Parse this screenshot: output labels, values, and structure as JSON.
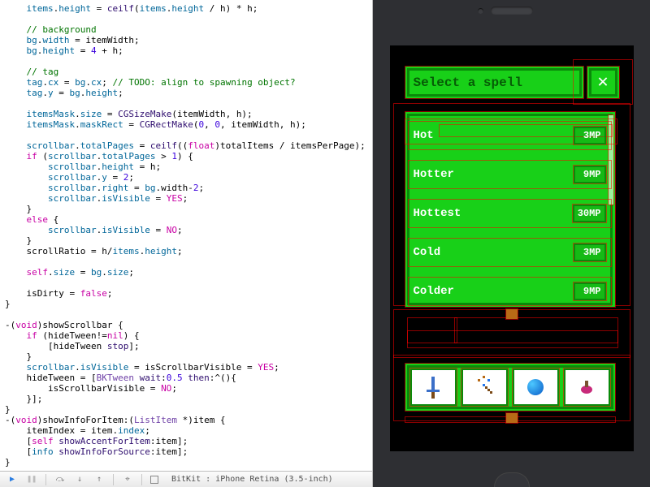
{
  "code": {
    "lines": [
      {
        "indent": 1,
        "segs": [
          {
            "t": "items",
            "c": "var"
          },
          {
            "t": ".",
            "c": ""
          },
          {
            "t": "height",
            "c": "var"
          },
          {
            "t": " = ",
            "c": ""
          },
          {
            "t": "ceilf",
            "c": "fn"
          },
          {
            "t": "(",
            "c": ""
          },
          {
            "t": "items",
            "c": "var"
          },
          {
            "t": ".",
            "c": ""
          },
          {
            "t": "height",
            "c": "var"
          },
          {
            "t": " / h) * h;",
            "c": ""
          }
        ]
      },
      {
        "indent": 0,
        "segs": []
      },
      {
        "indent": 1,
        "segs": [
          {
            "t": "// background",
            "c": "cmt"
          }
        ]
      },
      {
        "indent": 1,
        "segs": [
          {
            "t": "bg",
            "c": "var"
          },
          {
            "t": ".",
            "c": ""
          },
          {
            "t": "width",
            "c": "var"
          },
          {
            "t": " = itemWidth;",
            "c": ""
          }
        ]
      },
      {
        "indent": 1,
        "segs": [
          {
            "t": "bg",
            "c": "var"
          },
          {
            "t": ".",
            "c": ""
          },
          {
            "t": "height",
            "c": "var"
          },
          {
            "t": " = ",
            "c": ""
          },
          {
            "t": "4",
            "c": "num"
          },
          {
            "t": " + h;",
            "c": ""
          }
        ]
      },
      {
        "indent": 0,
        "segs": []
      },
      {
        "indent": 1,
        "segs": [
          {
            "t": "// tag",
            "c": "cmt"
          }
        ]
      },
      {
        "indent": 1,
        "segs": [
          {
            "t": "tag",
            "c": "var"
          },
          {
            "t": ".",
            "c": ""
          },
          {
            "t": "cx",
            "c": "var"
          },
          {
            "t": " = ",
            "c": ""
          },
          {
            "t": "bg",
            "c": "var"
          },
          {
            "t": ".",
            "c": ""
          },
          {
            "t": "cx",
            "c": "var"
          },
          {
            "t": "; ",
            "c": ""
          },
          {
            "t": "// TODO: align to spawning object?",
            "c": "cmt"
          }
        ]
      },
      {
        "indent": 1,
        "segs": [
          {
            "t": "tag",
            "c": "var"
          },
          {
            "t": ".",
            "c": ""
          },
          {
            "t": "y",
            "c": "var"
          },
          {
            "t": " = ",
            "c": ""
          },
          {
            "t": "bg",
            "c": "var"
          },
          {
            "t": ".",
            "c": ""
          },
          {
            "t": "height",
            "c": "var"
          },
          {
            "t": ";",
            "c": ""
          }
        ]
      },
      {
        "indent": 0,
        "segs": []
      },
      {
        "indent": 1,
        "segs": [
          {
            "t": "itemsMask",
            "c": "var"
          },
          {
            "t": ".",
            "c": ""
          },
          {
            "t": "size",
            "c": "var"
          },
          {
            "t": " = ",
            "c": ""
          },
          {
            "t": "CGSizeMake",
            "c": "fn"
          },
          {
            "t": "(itemWidth, h);",
            "c": ""
          }
        ]
      },
      {
        "indent": 1,
        "segs": [
          {
            "t": "itemsMask",
            "c": "var"
          },
          {
            "t": ".",
            "c": ""
          },
          {
            "t": "maskRect",
            "c": "var"
          },
          {
            "t": " = ",
            "c": ""
          },
          {
            "t": "CGRectMake",
            "c": "fn"
          },
          {
            "t": "(",
            "c": ""
          },
          {
            "t": "0",
            "c": "num"
          },
          {
            "t": ", ",
            "c": ""
          },
          {
            "t": "0",
            "c": "num"
          },
          {
            "t": ", itemWidth, h);",
            "c": ""
          }
        ]
      },
      {
        "indent": 0,
        "segs": []
      },
      {
        "indent": 1,
        "segs": [
          {
            "t": "scrollbar",
            "c": "var"
          },
          {
            "t": ".",
            "c": ""
          },
          {
            "t": "totalPages",
            "c": "var"
          },
          {
            "t": " = ",
            "c": ""
          },
          {
            "t": "ceilf",
            "c": "fn"
          },
          {
            "t": "((",
            "c": ""
          },
          {
            "t": "float",
            "c": "kw"
          },
          {
            "t": ")totalItems / itemsPerPage);",
            "c": ""
          }
        ]
      },
      {
        "indent": 1,
        "segs": [
          {
            "t": "if",
            "c": "kw"
          },
          {
            "t": " (",
            "c": ""
          },
          {
            "t": "scrollbar",
            "c": "var"
          },
          {
            "t": ".",
            "c": ""
          },
          {
            "t": "totalPages",
            "c": "var"
          },
          {
            "t": " > ",
            "c": ""
          },
          {
            "t": "1",
            "c": "num"
          },
          {
            "t": ") {",
            "c": ""
          }
        ]
      },
      {
        "indent": 2,
        "segs": [
          {
            "t": "scrollbar",
            "c": "var"
          },
          {
            "t": ".",
            "c": ""
          },
          {
            "t": "height",
            "c": "var"
          },
          {
            "t": " = h;",
            "c": ""
          }
        ]
      },
      {
        "indent": 2,
        "segs": [
          {
            "t": "scrollbar",
            "c": "var"
          },
          {
            "t": ".",
            "c": ""
          },
          {
            "t": "y",
            "c": "var"
          },
          {
            "t": " = ",
            "c": ""
          },
          {
            "t": "2",
            "c": "num"
          },
          {
            "t": ";",
            "c": ""
          }
        ]
      },
      {
        "indent": 2,
        "segs": [
          {
            "t": "scrollbar",
            "c": "var"
          },
          {
            "t": ".",
            "c": ""
          },
          {
            "t": "right",
            "c": "var"
          },
          {
            "t": " = ",
            "c": ""
          },
          {
            "t": "bg",
            "c": "var"
          },
          {
            "t": ".width-",
            "c": ""
          },
          {
            "t": "2",
            "c": "num"
          },
          {
            "t": ";",
            "c": ""
          }
        ]
      },
      {
        "indent": 2,
        "segs": [
          {
            "t": "scrollbar",
            "c": "var"
          },
          {
            "t": ".",
            "c": ""
          },
          {
            "t": "isVisible",
            "c": "var"
          },
          {
            "t": " = ",
            "c": ""
          },
          {
            "t": "YES",
            "c": "kw"
          },
          {
            "t": ";",
            "c": ""
          }
        ]
      },
      {
        "indent": 1,
        "segs": [
          {
            "t": "}",
            "c": ""
          }
        ]
      },
      {
        "indent": 1,
        "segs": [
          {
            "t": "else",
            "c": "kw"
          },
          {
            "t": " {",
            "c": ""
          }
        ]
      },
      {
        "indent": 2,
        "segs": [
          {
            "t": "scrollbar",
            "c": "var"
          },
          {
            "t": ".",
            "c": ""
          },
          {
            "t": "isVisible",
            "c": "var"
          },
          {
            "t": " = ",
            "c": ""
          },
          {
            "t": "NO",
            "c": "kw"
          },
          {
            "t": ";",
            "c": ""
          }
        ]
      },
      {
        "indent": 1,
        "segs": [
          {
            "t": "}",
            "c": ""
          }
        ]
      },
      {
        "indent": 1,
        "segs": [
          {
            "t": "scrollRatio = h/",
            "c": ""
          },
          {
            "t": "items",
            "c": "var"
          },
          {
            "t": ".",
            "c": ""
          },
          {
            "t": "height",
            "c": "var"
          },
          {
            "t": ";",
            "c": ""
          }
        ]
      },
      {
        "indent": 0,
        "segs": []
      },
      {
        "indent": 1,
        "segs": [
          {
            "t": "self",
            "c": "kw"
          },
          {
            "t": ".",
            "c": ""
          },
          {
            "t": "size",
            "c": "var"
          },
          {
            "t": " = ",
            "c": ""
          },
          {
            "t": "bg",
            "c": "var"
          },
          {
            "t": ".",
            "c": ""
          },
          {
            "t": "size",
            "c": "var"
          },
          {
            "t": ";",
            "c": ""
          }
        ]
      },
      {
        "indent": 0,
        "segs": []
      },
      {
        "indent": 1,
        "segs": [
          {
            "t": "isDirty = ",
            "c": ""
          },
          {
            "t": "false",
            "c": "kw"
          },
          {
            "t": ";",
            "c": ""
          }
        ]
      },
      {
        "indent": 0,
        "segs": [
          {
            "t": "}",
            "c": ""
          }
        ]
      },
      {
        "indent": 0,
        "segs": []
      },
      {
        "indent": 0,
        "segs": [
          {
            "t": "-(",
            "c": ""
          },
          {
            "t": "void",
            "c": "kw"
          },
          {
            "t": ")showScrollbar {",
            "c": ""
          }
        ]
      },
      {
        "indent": 1,
        "segs": [
          {
            "t": "if",
            "c": "kw"
          },
          {
            "t": " (hideTween!=",
            "c": ""
          },
          {
            "t": "nil",
            "c": "kw"
          },
          {
            "t": ") {",
            "c": ""
          }
        ]
      },
      {
        "indent": 2,
        "segs": [
          {
            "t": "[hideTween ",
            "c": ""
          },
          {
            "t": "stop",
            "c": "fn"
          },
          {
            "t": "];",
            "c": ""
          }
        ]
      },
      {
        "indent": 1,
        "segs": [
          {
            "t": "}",
            "c": ""
          }
        ]
      },
      {
        "indent": 1,
        "segs": [
          {
            "t": "scrollbar",
            "c": "var"
          },
          {
            "t": ".",
            "c": ""
          },
          {
            "t": "isVisible",
            "c": "var"
          },
          {
            "t": " = isScrollbarVisible = ",
            "c": ""
          },
          {
            "t": "YES",
            "c": "kw"
          },
          {
            "t": ";",
            "c": ""
          }
        ]
      },
      {
        "indent": 1,
        "segs": [
          {
            "t": "hideTween = [",
            "c": ""
          },
          {
            "t": "BKTween",
            "c": "type"
          },
          {
            "t": " ",
            "c": ""
          },
          {
            "t": "wait",
            "c": "fn"
          },
          {
            "t": ":",
            "c": ""
          },
          {
            "t": "0.5",
            "c": "num"
          },
          {
            "t": " ",
            "c": ""
          },
          {
            "t": "then",
            "c": "fn"
          },
          {
            "t": ":^(){",
            "c": ""
          }
        ]
      },
      {
        "indent": 2,
        "segs": [
          {
            "t": "isScrollbarVisible = ",
            "c": ""
          },
          {
            "t": "NO",
            "c": "kw"
          },
          {
            "t": ";",
            "c": ""
          }
        ]
      },
      {
        "indent": 1,
        "segs": [
          {
            "t": "}];",
            "c": ""
          }
        ]
      },
      {
        "indent": 0,
        "segs": [
          {
            "t": "}",
            "c": ""
          }
        ]
      },
      {
        "indent": 0,
        "segs": [
          {
            "t": "-(",
            "c": ""
          },
          {
            "t": "void",
            "c": "kw"
          },
          {
            "t": ")showInfoForItem:(",
            "c": ""
          },
          {
            "t": "ListItem",
            "c": "type"
          },
          {
            "t": " *)item {",
            "c": ""
          }
        ]
      },
      {
        "indent": 1,
        "segs": [
          {
            "t": "itemIndex = item.",
            "c": ""
          },
          {
            "t": "index",
            "c": "var"
          },
          {
            "t": ";",
            "c": ""
          }
        ]
      },
      {
        "indent": 1,
        "segs": [
          {
            "t": "[",
            "c": ""
          },
          {
            "t": "self",
            "c": "kw"
          },
          {
            "t": " ",
            "c": ""
          },
          {
            "t": "showAccentForItem",
            "c": "fn"
          },
          {
            "t": ":item];",
            "c": ""
          }
        ]
      },
      {
        "indent": 1,
        "segs": [
          {
            "t": "[",
            "c": ""
          },
          {
            "t": "info",
            "c": "var"
          },
          {
            "t": " ",
            "c": ""
          },
          {
            "t": "showInfoForSource",
            "c": "fn"
          },
          {
            "t": ":item];",
            "c": ""
          }
        ]
      },
      {
        "indent": 0,
        "segs": [
          {
            "t": "}",
            "c": ""
          }
        ]
      }
    ]
  },
  "debugbar": {
    "target": "BitKit : iPhone Retina (3.5-inch)"
  },
  "game": {
    "title": "Select a spell",
    "close": "✕",
    "spells": [
      {
        "name": "Hot",
        "cost": "3MP"
      },
      {
        "name": "Hotter",
        "cost": "9MP"
      },
      {
        "name": "Hottest",
        "cost": "30MP"
      },
      {
        "name": "Cold",
        "cost": "3MP"
      },
      {
        "name": "Colder",
        "cost": "9MP"
      }
    ],
    "toolbar": [
      "sword",
      "wand",
      "orb",
      "potion"
    ]
  }
}
